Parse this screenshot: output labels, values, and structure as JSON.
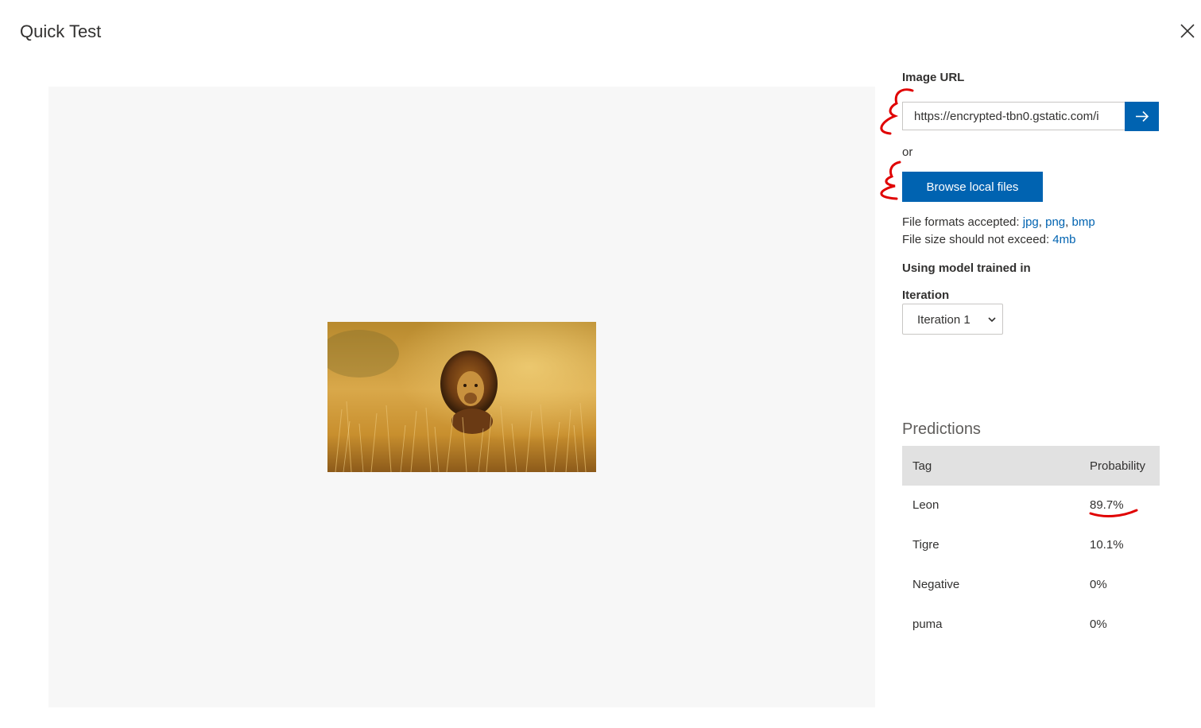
{
  "dialog": {
    "title": "Quick Test"
  },
  "form": {
    "image_url_label": "Image URL",
    "image_url_value": "https://encrypted-tbn0.gstatic.com/i",
    "or_text": "or",
    "browse_label": "Browse local files",
    "formats_prefix": "File formats accepted: ",
    "formats": [
      "jpg",
      "png",
      "bmp"
    ],
    "size_prefix": "File size should not exceed: ",
    "size_value": "4mb",
    "model_label": "Using model trained in",
    "iteration_label": "Iteration",
    "iteration_selected": "Iteration 1"
  },
  "predictions": {
    "title": "Predictions",
    "columns": [
      "Tag",
      "Probability"
    ],
    "rows": [
      {
        "tag": "Leon",
        "probability": "89.7%"
      },
      {
        "tag": "Tigre",
        "probability": "10.1%"
      },
      {
        "tag": "Negative",
        "probability": "0%"
      },
      {
        "tag": "puma",
        "probability": "0%"
      }
    ]
  },
  "colors": {
    "accent": "#0063b1",
    "annotation": "#e00000",
    "preview_bg": "#f7f7f7"
  },
  "icons": {
    "close": "close-icon",
    "go": "arrow-right-icon",
    "dropdown": "chevron-down-icon"
  }
}
